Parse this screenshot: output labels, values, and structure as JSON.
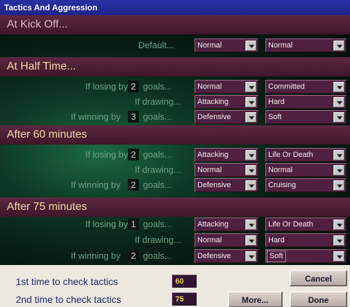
{
  "window": {
    "title": "Tactics And Aggression"
  },
  "colors": {
    "title_bar": "#2a2fa3",
    "section_band": "#5c2840",
    "dropdown_bg": "#4f2140",
    "panel_green": "#1b6a45"
  },
  "kickoff": {
    "heading": "At Kick Off...",
    "default_label": "Default",
    "default_ellipsis": "...",
    "tactic": "Normal",
    "aggression": "Normal"
  },
  "half_time": {
    "heading": "At Half Time...",
    "losing_prefix": "If losing by",
    "losing_goals": "2",
    "losing_suffix": "goals...",
    "losing_tactic": "Normal",
    "losing_aggression": "Committed",
    "drawing_label": "If drawing...",
    "drawing_tactic": "Attacking",
    "drawing_aggression": "Hard",
    "winning_prefix": "If winning by",
    "winning_goals": "3",
    "winning_suffix": "goals...",
    "winning_tactic": "Defensive",
    "winning_aggression": "Soft"
  },
  "after_60": {
    "heading": "After 60 minutes",
    "losing_prefix": "If losing by",
    "losing_goals": "2",
    "losing_suffix": "goals...",
    "losing_tactic": "Attacking",
    "losing_aggression": "Life Or Death",
    "drawing_label": "If drawing...",
    "drawing_tactic": "Normal",
    "drawing_aggression": "Normal",
    "winning_prefix": "If winning by",
    "winning_goals": "2",
    "winning_suffix": "goals...",
    "winning_tactic": "Defensive",
    "winning_aggression": "Cruising"
  },
  "after_75": {
    "heading": "After 75 minutes",
    "losing_prefix": "If losing by",
    "losing_goals": "1",
    "losing_suffix": "goals...",
    "losing_tactic": "Attacking",
    "losing_aggression": "Life Or Death",
    "drawing_label": "If drawing...",
    "drawing_tactic": "Normal",
    "drawing_aggression": "Hard",
    "winning_prefix": "If winning by",
    "winning_goals": "2",
    "winning_suffix": "goals...",
    "winning_tactic": "Defensive",
    "winning_aggression": "Soft"
  },
  "checks": {
    "first_label": "1st time to check tactics",
    "first_value": "60",
    "second_label": "2nd time to check tactics",
    "second_value": "75"
  },
  "buttons": {
    "cancel": "Cancel",
    "more": "More...",
    "done": "Done"
  }
}
